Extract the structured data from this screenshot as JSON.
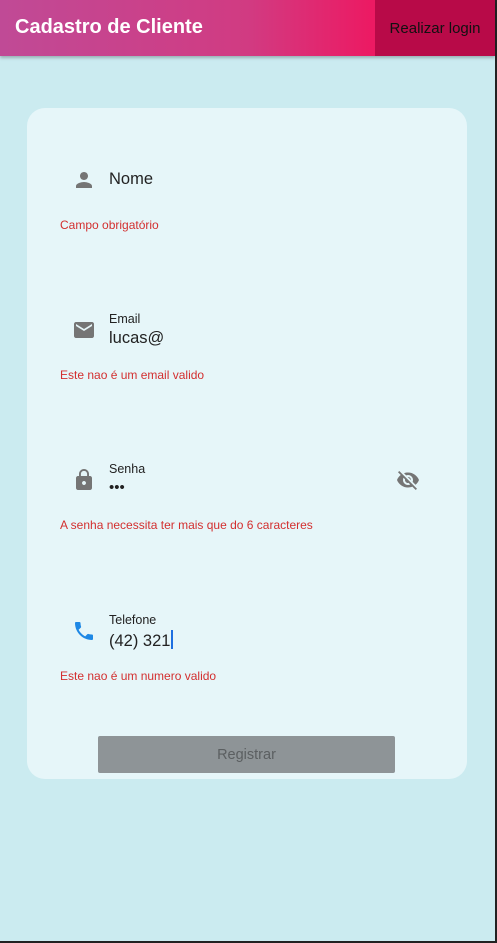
{
  "appbar": {
    "title": "Cadastro de Cliente",
    "login_label": "Realizar login"
  },
  "form": {
    "name": {
      "placeholder": "Nome",
      "error": "Campo obrigatório",
      "icon": "person-icon"
    },
    "email": {
      "label": "Email",
      "value": "lucas@",
      "error": "Este nao é um email valido",
      "icon": "mail-icon"
    },
    "password": {
      "label": "Senha",
      "value": "•••",
      "error": "A senha necessita ter mais que do 6 caracteres",
      "icon": "lock-icon",
      "toggle_icon": "visibility-off-icon"
    },
    "phone": {
      "label": "Telefone",
      "value": "(42) 321",
      "error": "Este nao é um numero valido",
      "icon": "phone-icon"
    },
    "register_label": "Registrar"
  },
  "colors": {
    "background": "#cbebf0",
    "card": "#e6f6f9",
    "error": "#d32f2f",
    "phone_icon": "#1e88e5",
    "button_disabled": "#8e9497"
  }
}
